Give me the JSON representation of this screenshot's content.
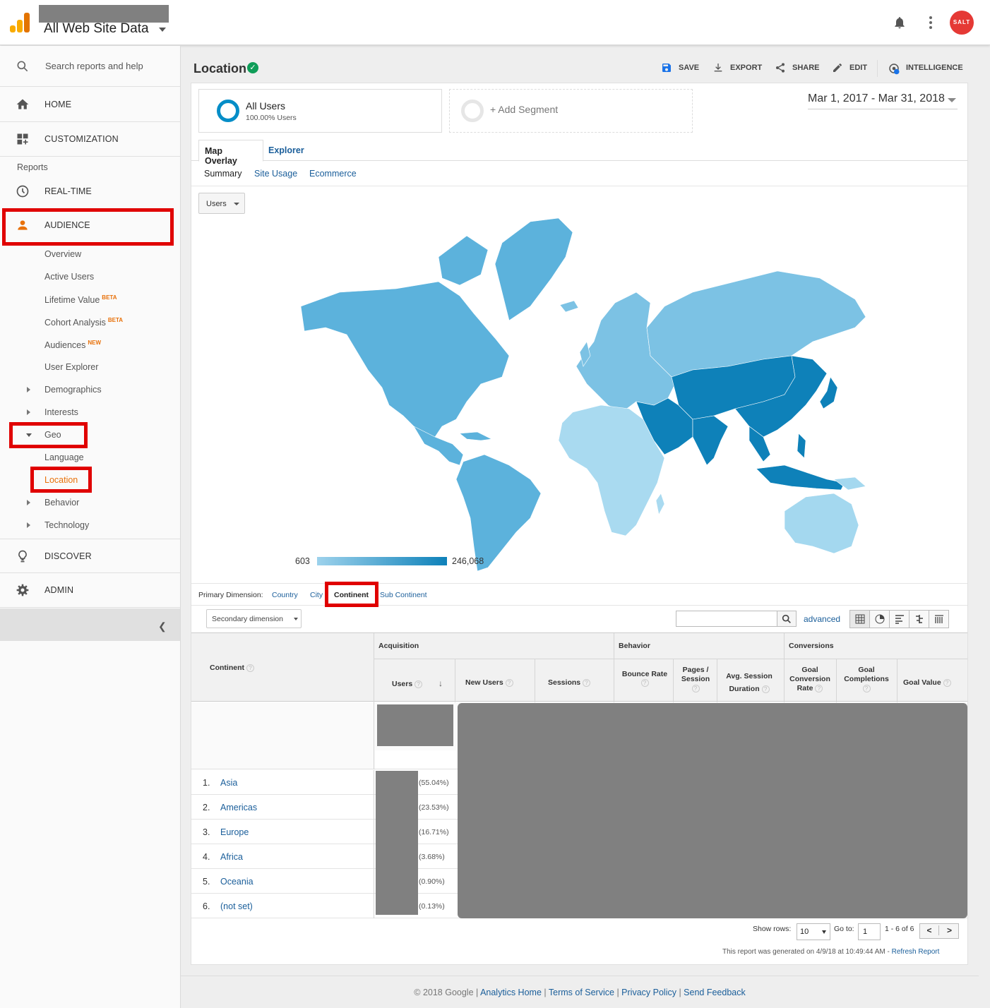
{
  "topbar": {
    "property_name": "All Web Site Data",
    "avatar_text": "SALT",
    "avatar_color": "#e53935"
  },
  "sidebar": {
    "search_placeholder": "Search reports and help",
    "home": "HOME",
    "customization": "CUSTOMIZATION",
    "reports_label": "Reports",
    "realtime": "REAL-TIME",
    "audience": "AUDIENCE",
    "audience_items": [
      "Overview",
      "Active Users",
      "Lifetime Value",
      "Cohort Analysis",
      "Audiences",
      "User Explorer",
      "Demographics",
      "Interests",
      "Geo",
      "Language",
      "Location",
      "Behavior",
      "Technology"
    ],
    "badges": {
      "beta": "BETA",
      "new": "NEW"
    },
    "discover": "DISCOVER",
    "admin": "ADMIN",
    "accent_color": "#e8710a",
    "highlight_color": "#e00000"
  },
  "header": {
    "title": "Location",
    "actions": {
      "save": "SAVE",
      "export": "EXPORT",
      "share": "SHARE",
      "edit": "EDIT",
      "intelligence": "INTELLIGENCE"
    },
    "intelligence_badge": "1"
  },
  "segments": {
    "active_title": "All Users",
    "active_sub": "100.00% Users",
    "add_label": "+ Add Segment"
  },
  "date_range": "Mar 1, 2017 - Mar 31, 2018",
  "tabs": [
    "Map Overlay",
    "Explorer"
  ],
  "subtabs": [
    "Summary",
    "Site Usage",
    "Ecommerce"
  ],
  "map": {
    "metric": "Users",
    "legend_min": "603",
    "legend_max": "246,068",
    "colors": {
      "asia": "#0e81b9",
      "americas": "#5cb2dc",
      "europe": "#7cc2e4",
      "africa": "#a9daf0",
      "oceania": "#a4d8ef"
    }
  },
  "primary_dimension": {
    "label": "Primary Dimension:",
    "options": [
      "Country",
      "City",
      "Continent",
      "Sub Continent"
    ],
    "selected": "Continent"
  },
  "table_controls": {
    "secondary_dimension": "Secondary dimension",
    "advanced": "advanced"
  },
  "table": {
    "dim_header": "Continent",
    "groups": {
      "acquisition": "Acquisition",
      "behavior": "Behavior",
      "conversions": "Conversions"
    },
    "columns": {
      "users": "Users",
      "new_users": "New Users",
      "sessions": "Sessions",
      "bounce_rate": "Bounce Rate",
      "pages_session": "Pages / Session",
      "avg_session": "Avg. Session Duration",
      "goal_conv": "Goal Conversion Rate",
      "goal_comp": "Goal Completions",
      "goal_value": "Goal Value"
    },
    "rows": [
      {
        "n": "1.",
        "name": "Asia",
        "pct": "(55.04%)"
      },
      {
        "n": "2.",
        "name": "Americas",
        "pct": "(23.53%)"
      },
      {
        "n": "3.",
        "name": "Europe",
        "pct": "(16.71%)"
      },
      {
        "n": "4.",
        "name": "Africa",
        "pct": "(3.68%)"
      },
      {
        "n": "5.",
        "name": "Oceania",
        "pct": "(0.90%)"
      },
      {
        "n": "6.",
        "name": "(not set)",
        "pct": "(0.13%)"
      }
    ]
  },
  "pager": {
    "show_rows": "Show rows:",
    "rows_value": "10",
    "goto": "Go to:",
    "goto_value": "1",
    "range": "1 - 6 of 6",
    "prev": "<",
    "next": ">"
  },
  "report_note": "This report was generated on 4/9/18 at 10:49:44 AM -",
  "refresh": "Refresh Report",
  "footer": {
    "copyright": "© 2018 Google",
    "links": [
      "Analytics Home",
      "Terms of Service",
      "Privacy Policy",
      "Send Feedback"
    ]
  }
}
